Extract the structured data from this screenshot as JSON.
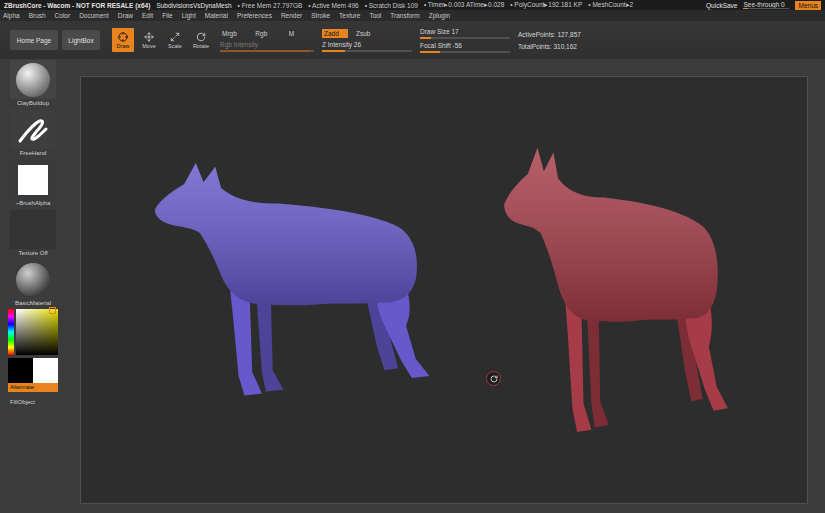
{
  "title_bar": {
    "app": "ZBrushCore - Wacom - NOT FOR RESALE (x64)",
    "document": "SubdivisionsVsDynaMesh",
    "stats": [
      "• Free Mem 27.797GB",
      "• Active Mem 496",
      "• Scratch Disk 109",
      "• Timer▸0.003 ATime▸0.028",
      "• PolyCount▸192.181 KP",
      "• MeshCount▸2"
    ],
    "quicksave": "QuickSave",
    "see_through": {
      "label": "See-through",
      "value": "0",
      "level": 0.1
    },
    "menus": {
      "label": "Menus",
      "selected": true
    }
  },
  "menu_bar": [
    "Alpha",
    "Brush",
    "Color",
    "Document",
    "Draw",
    "Edit",
    "File",
    "Light",
    "Material",
    "Preferences",
    "Render",
    "Stroke",
    "Texture",
    "Tool",
    "Transform",
    "Zplugin"
  ],
  "toolbar": {
    "nav_buttons": [
      "Home Page",
      "LightBox"
    ],
    "modes": [
      {
        "label": "Draw",
        "selected": true
      },
      {
        "label": "Move",
        "selected": false
      },
      {
        "label": "Scale",
        "selected": false
      },
      {
        "label": "Rotate",
        "selected": false
      }
    ],
    "color_modes": [
      {
        "label": "Mrgb",
        "selected": false
      },
      {
        "label": "Rgb",
        "selected": false
      },
      {
        "label": "M",
        "selected": false
      }
    ],
    "rgb_intensity": {
      "label": "Rgb Intensity",
      "disabled": true,
      "level": 0.97
    },
    "z_modes": [
      {
        "label": "Zadd",
        "selected": true
      },
      {
        "label": "Zsub",
        "selected": false
      }
    ],
    "z_intensity": {
      "label": "Z Intensity",
      "value": "26",
      "level": 0.26
    },
    "draw_size": {
      "label": "Draw Size",
      "value": "17",
      "level": 0.12
    },
    "focal_shift": {
      "label": "Focal Shift",
      "value": "-56",
      "level": 0.22
    },
    "points": [
      {
        "label": "ActivePoints:",
        "value": "127,857"
      },
      {
        "label": "TotalPoints:",
        "value": "310,162"
      }
    ]
  },
  "shelf": {
    "brush": "ClayBuildup",
    "stroke": "FreeHand",
    "alpha": "~BrushAlpha",
    "texture": "Texture Off",
    "material": "BasicMaterial",
    "swatches": [
      {
        "color": "#000000"
      },
      {
        "color": "#ffffff"
      }
    ],
    "alternate": {
      "label": "Alternate",
      "selected": true
    },
    "fill_object": "FillObject"
  },
  "canvas": {
    "models": [
      {
        "color": "#6759cb"
      },
      {
        "color": "#a63c48"
      }
    ]
  }
}
